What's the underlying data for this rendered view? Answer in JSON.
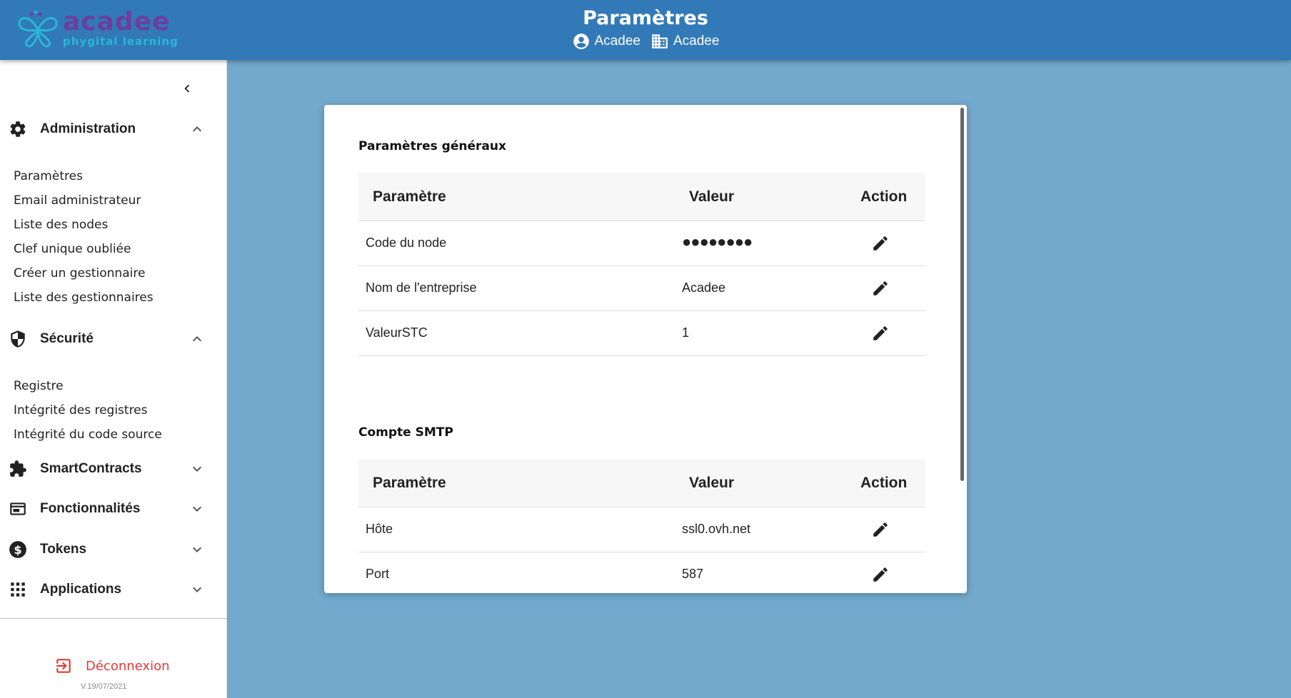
{
  "brand": {
    "name": "acadee",
    "tagline": "phygital learning"
  },
  "header": {
    "title": "Paramètres",
    "user": "Acadee",
    "company": "Acadee"
  },
  "sidebar": {
    "groups": [
      {
        "label": "Administration",
        "icon": "gear-icon",
        "expanded": true,
        "items": [
          "Paramètres",
          "Email administrateur",
          "Liste des nodes",
          "Clef unique oubliée",
          "Créer un gestionnaire",
          "Liste des gestionnaires"
        ]
      },
      {
        "label": "Sécurité",
        "icon": "shield-icon",
        "expanded": true,
        "items": [
          "Registre",
          "Intégrité des registres",
          "Intégrité du code source"
        ]
      },
      {
        "label": "SmartContracts",
        "icon": "puzzle-icon",
        "expanded": false
      },
      {
        "label": "Fonctionnalités",
        "icon": "window-icon",
        "expanded": false
      },
      {
        "label": "Tokens",
        "icon": "dollar-icon",
        "expanded": false
      },
      {
        "label": "Applications",
        "icon": "grid-icon",
        "expanded": false
      }
    ],
    "logout": "Déconnexion",
    "version": "V.19/07/2021"
  },
  "general": {
    "title": "Paramètres généraux",
    "headers": [
      "Paramètre",
      "Valeur",
      "Action"
    ],
    "rows": [
      {
        "param": "Code du node",
        "value": "●●●●●●●●"
      },
      {
        "param": "Nom de l'entreprise",
        "value": "Acadee"
      },
      {
        "param": "ValeurSTC",
        "value": "1"
      }
    ]
  },
  "smtp": {
    "title": "Compte SMTP",
    "headers": [
      "Paramètre",
      "Valeur",
      "Action"
    ],
    "rows": [
      {
        "param": "Hôte",
        "value": "ssl0.ovh.net"
      },
      {
        "param": "Port",
        "value": "587"
      }
    ]
  },
  "colors": {
    "header": "#3279b7",
    "background": "#72a9cc",
    "logout": "#e53935"
  }
}
